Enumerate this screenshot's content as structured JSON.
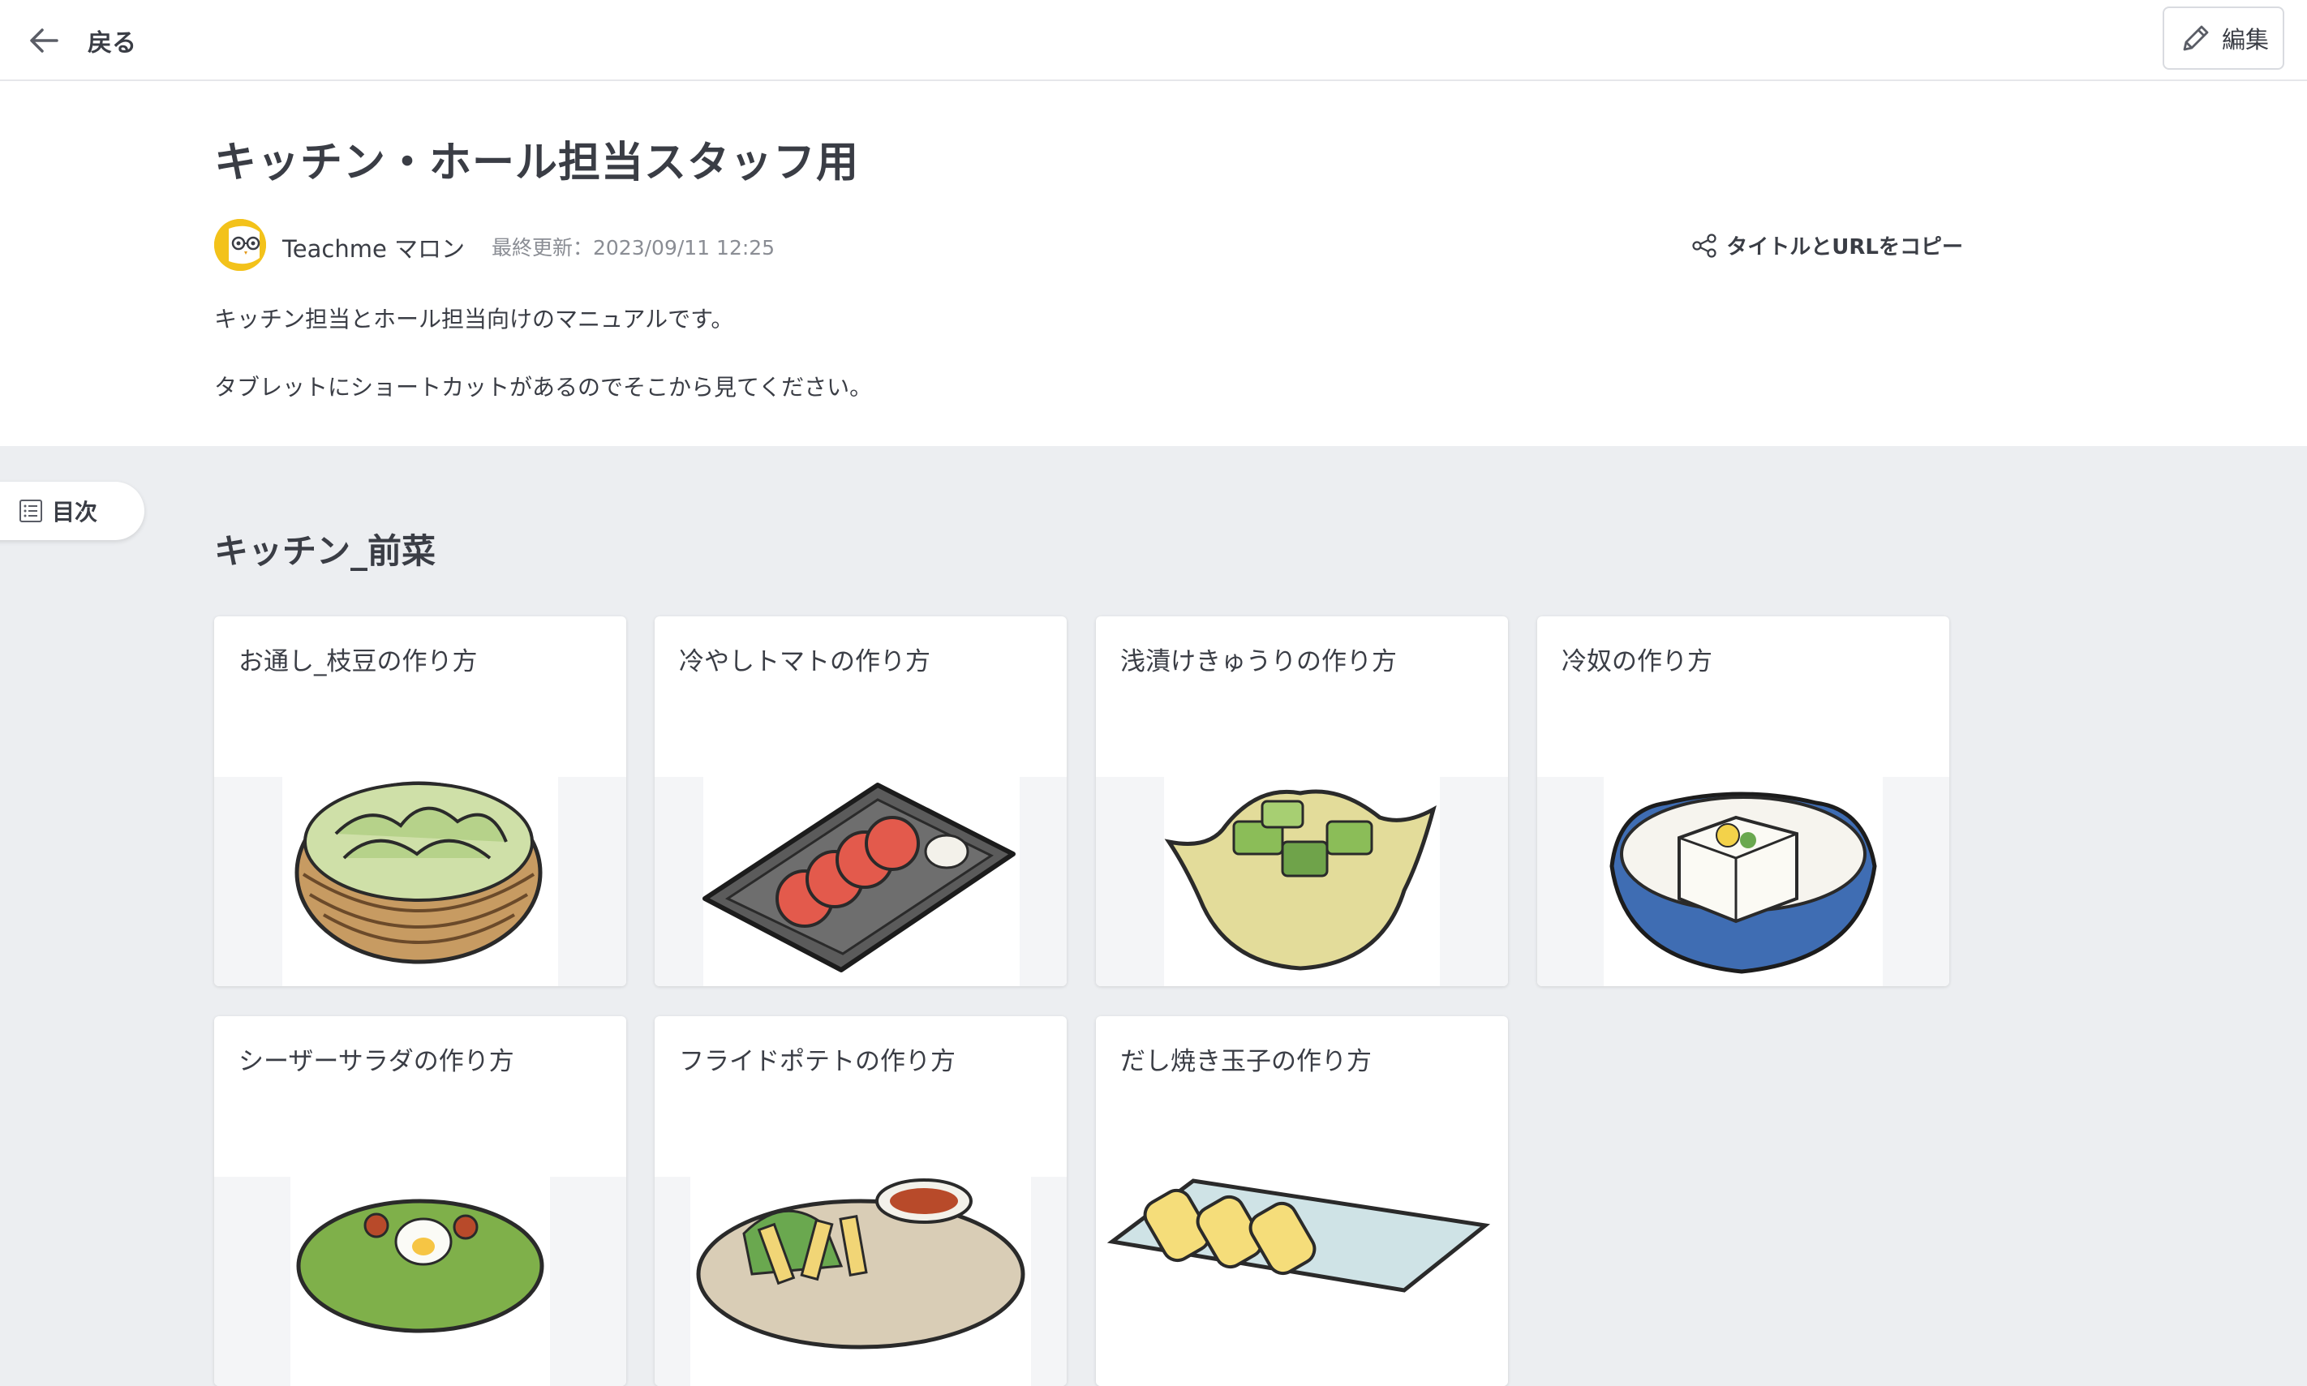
{
  "topbar": {
    "back_label": "戻る",
    "edit_label": "編集"
  },
  "page": {
    "title": "キッチン・ホール担当スタッフ用",
    "author": "Teachme マロン",
    "updated": "最終更新：2023/09/11 12:25",
    "copy_label": "タイトルとURLをコピー",
    "description": [
      "キッチン担当とホール担当向けのマニュアルです。",
      "タブレットにショートカットがあるのでそこから見てください。"
    ]
  },
  "toc": {
    "label": "目次"
  },
  "section": {
    "title": "キッチン_前菜",
    "cards": [
      {
        "title": "お通し_枝豆の作り方",
        "image_icon": "edamame-icon"
      },
      {
        "title": "冷やしトマトの作り方",
        "image_icon": "tomato-icon"
      },
      {
        "title": "浅漬けきゅうりの作り方",
        "image_icon": "cucumber-icon"
      },
      {
        "title": "冷奴の作り方",
        "image_icon": "tofu-icon"
      },
      {
        "title": "シーザーサラダの作り方",
        "image_icon": "salad-icon"
      },
      {
        "title": "フライドポテトの作り方",
        "image_icon": "fries-icon"
      },
      {
        "title": "だし焼き玉子の作り方",
        "image_icon": "tamagoyaki-icon"
      }
    ]
  },
  "colors": {
    "background": "#eceef1",
    "text": "#3a3d45",
    "avatar": "#f3c21a"
  }
}
